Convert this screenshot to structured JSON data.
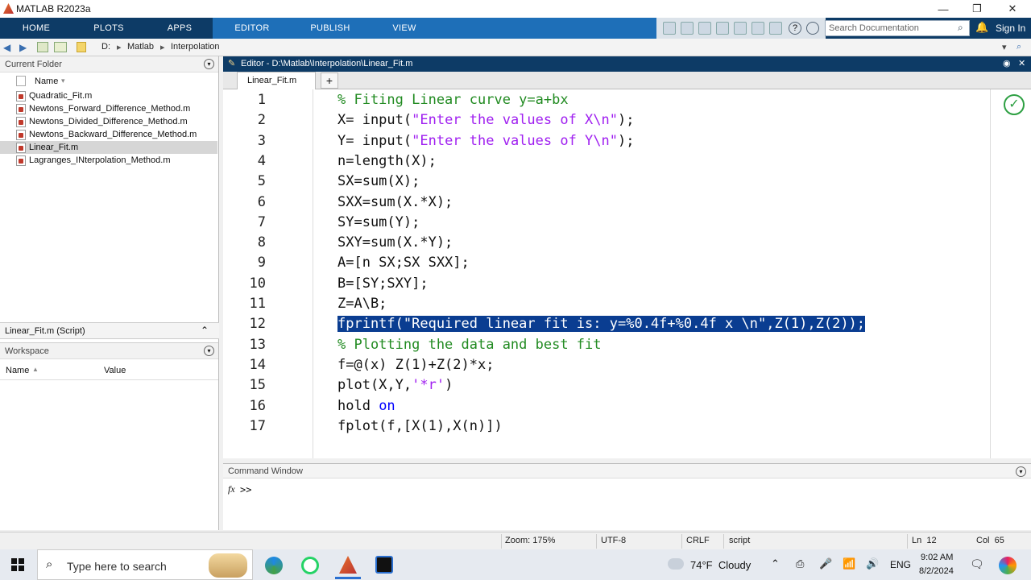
{
  "window": {
    "title": "MATLAB R2023a",
    "minimize": "—",
    "restore": "❐",
    "close": "✕"
  },
  "ribbon": {
    "tabs": [
      "HOME",
      "PLOTS",
      "APPS",
      "EDITOR",
      "PUBLISH",
      "VIEW"
    ],
    "search_placeholder": "Search Documentation",
    "sign_in": "Sign In"
  },
  "address": {
    "parts": [
      "D:",
      "Matlab",
      "Interpolation"
    ]
  },
  "current_folder": {
    "title": "Current Folder",
    "col_name": "Name",
    "files": [
      "Quadratic_Fit.m",
      "Newtons_Forward_Difference_Method.m",
      "Newtons_Divided_Difference_Method.m",
      "Newtons_Backward_Difference_Method.m",
      "Linear_Fit.m",
      "Lagranges_INterpolation_Method.m"
    ],
    "selected_index": 4
  },
  "details": {
    "label": "Linear_Fit.m  (Script)"
  },
  "workspace": {
    "title": "Workspace",
    "col_name": "Name",
    "col_value": "Value"
  },
  "editor": {
    "header": "Editor - D:\\Matlab\\Interpolation\\Linear_Fit.m",
    "tab": "Linear_Fit.m",
    "add_tab": "+"
  },
  "code_lines": [
    "% Fiting Linear curve y=a+bx",
    "X= input(\"Enter the values of X\\n\");",
    "Y= input(\"Enter the values of Y\\n\");",
    "n=length(X);",
    "SX=sum(X);",
    "SXX=sum(X.*X);",
    "SY=sum(Y);",
    "SXY=sum(X.*Y);",
    "A=[n SX;SX SXX];",
    "B=[SY;SXY];",
    "Z=A\\B;",
    "fprintf(\"Required linear fit is: y=%0.4f+%0.4f x \\n\",Z(1),Z(2));",
    "% Plotting the data and best fit",
    "f=@(x) Z(1)+Z(2)*x;",
    "plot(X,Y,'*r')",
    "hold on",
    "fplot(f,[X(1),X(n)])"
  ],
  "line_numbers": [
    "1",
    "2",
    "3",
    "4",
    "5",
    "6",
    "7",
    "8",
    "9",
    "10",
    "11",
    "12",
    "13",
    "14",
    "15",
    "16",
    "17"
  ],
  "command_window": {
    "title": "Command Window",
    "prompt": ">>",
    "fx": "fx"
  },
  "status": {
    "zoom": "Zoom: 175%",
    "encoding": "UTF-8",
    "eol": "CRLF",
    "type": "script",
    "ln": "Ln  12",
    "col": "Col  65"
  },
  "taskbar": {
    "search": "Type here to search",
    "weather": "74°F  Cloudy",
    "lang": "ENG",
    "time": "9:02 AM",
    "date": "8/2/2024"
  }
}
